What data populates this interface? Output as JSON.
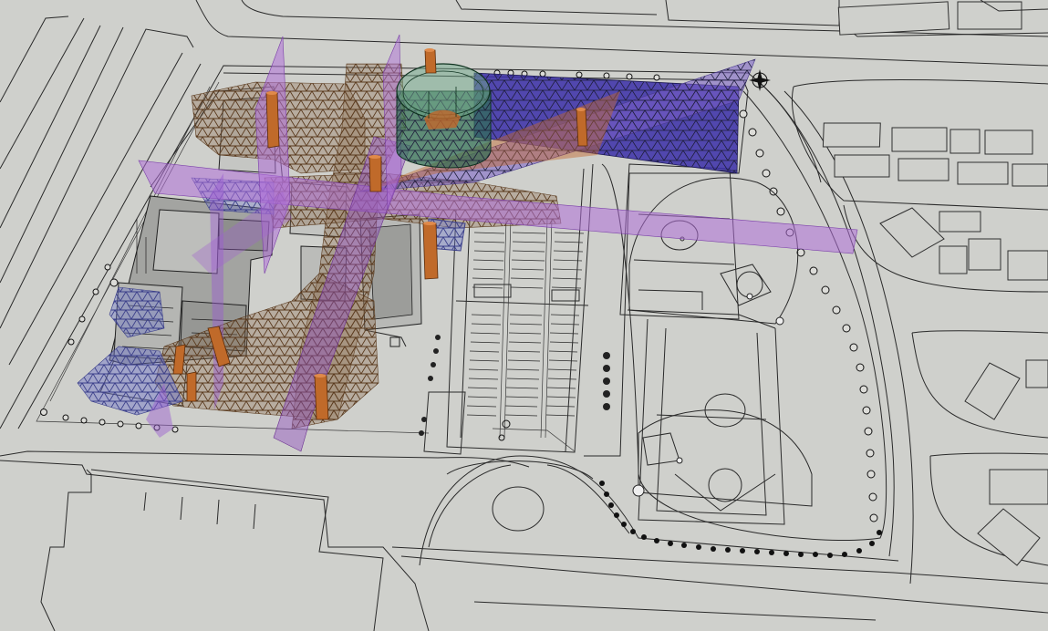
{
  "colors": {
    "ground": "#cfd0cc",
    "linework": "#2a2a2a",
    "violet_plane": "#4a3fb0",
    "purple_plane": "#b070d8",
    "lattice_bronze": "#7a5230",
    "lattice_blue": "#5a62b8",
    "column_orange": "#c06a2a",
    "cylinder_green": "#2f6f52",
    "building_gray": "#a9aaa8"
  },
  "icons": {
    "north_arrow": "north-arrow-icon"
  },
  "scene_objects": [
    "road-network",
    "campus-site-boundary",
    "west-building-complex",
    "central-gymnasium",
    "parking-lot",
    "sports-fields",
    "softball-diamond",
    "baseball-diamond",
    "perimeter-trees",
    "central-roundabout",
    "south-building-footprint",
    "east-neighborhood-blocks",
    "diagonal-street-grid",
    "violet-triangular-plane",
    "purple-band-planes",
    "diagrid-lattice-canopy",
    "glass-cylinder-tower",
    "orange-columns"
  ]
}
